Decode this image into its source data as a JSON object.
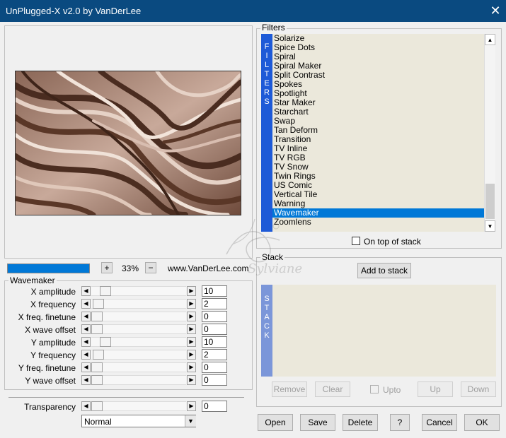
{
  "window": {
    "title": "UnPlugged-X v2.0 by VanDerLee"
  },
  "icons": {
    "close": "close-icon",
    "arrow_left": "arrow-left-icon",
    "arrow_right": "arrow-right-icon",
    "arrow_up": "arrow-up-icon",
    "arrow_down": "arrow-down-icon",
    "chevron_down": "chevron-down-icon"
  },
  "zoom": {
    "plus": "+",
    "minus": "−",
    "value": "33%"
  },
  "website": "www.VanDerLee.com",
  "filters": {
    "label": "Filters",
    "vertical_label": [
      "F",
      "I",
      "L",
      "T",
      "E",
      "R",
      "S"
    ],
    "items": [
      "Solarize",
      "Spice Dots",
      "Spiral",
      "Spiral Maker",
      "Split Contrast",
      "Spokes",
      "Spotlight",
      "Star Maker",
      "Starchart",
      "Swap",
      "Tan Deform",
      "Transition",
      "TV Inline",
      "TV RGB",
      "TV Snow",
      "Twin Rings",
      "US Comic",
      "Vertical Tile",
      "Warning",
      "Wavemaker",
      "Zoomlens"
    ],
    "selected": "Wavemaker",
    "on_top_label": "On top of stack"
  },
  "stack": {
    "label": "Stack",
    "add_button": "Add to stack",
    "vertical_label": [
      "S",
      "T",
      "A",
      "C",
      "K"
    ],
    "remove": "Remove",
    "clear": "Clear",
    "upto": "Upto",
    "up": "Up",
    "down": "Down"
  },
  "wavemaker": {
    "label": "Wavemaker",
    "params": [
      {
        "label": "X amplitude",
        "value": "10",
        "level": 0.1
      },
      {
        "label": "X frequency",
        "value": "2",
        "level": 0.02
      },
      {
        "label": "X freq. finetune",
        "value": "0",
        "level": 0
      },
      {
        "label": "X wave offset",
        "value": "0",
        "level": 0
      },
      {
        "label": "Y amplitude",
        "value": "10",
        "level": 0.1
      },
      {
        "label": "Y frequency",
        "value": "2",
        "level": 0.02
      },
      {
        "label": "Y freq. finetune",
        "value": "0",
        "level": 0
      },
      {
        "label": "Y wave offset",
        "value": "0",
        "level": 0
      }
    ]
  },
  "transparency": {
    "label": "Transparency",
    "value": "0",
    "level": 0
  },
  "blend_mode": {
    "value": "Normal"
  },
  "buttons": {
    "open": "Open",
    "save": "Save",
    "delete": "Delete",
    "help": "?",
    "cancel": "Cancel",
    "ok": "OK"
  },
  "watermark": {
    "text": "Sylviane"
  },
  "colors": {
    "titlebar": "#0a4a80",
    "accent": "#0078d7",
    "panel_bg": "#ebe8db"
  }
}
